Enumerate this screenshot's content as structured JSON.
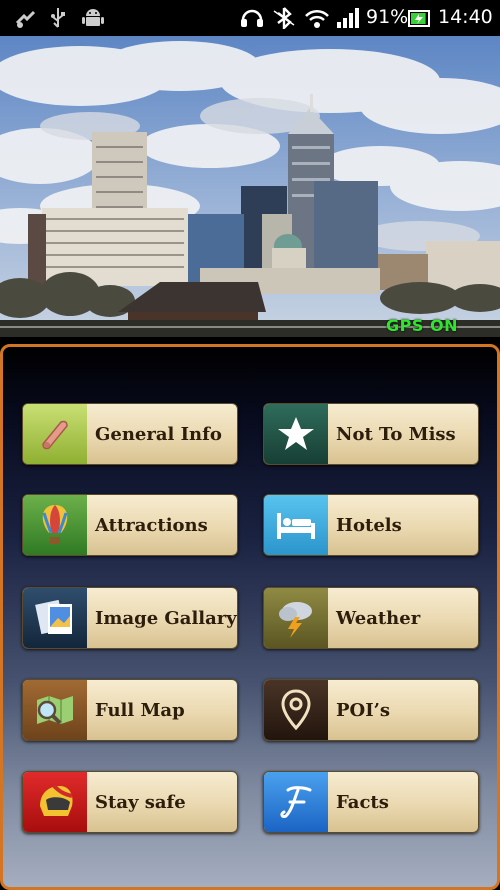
{
  "status_bar": {
    "icons_left": [
      "signal-sync-icon",
      "usb-icon",
      "android-icon"
    ],
    "icons_right": [
      "headset-icon",
      "bluetooth-icon",
      "wifi-icon",
      "cell-signal-icon"
    ],
    "battery_percent": "91%",
    "battery_level": 0.91,
    "time": "14:40"
  },
  "hero": {
    "gps_status": "GPS ON",
    "gps_color": "#2ee62e"
  },
  "menu": {
    "items": [
      {
        "label": "General Info",
        "icon": "scroll-icon"
      },
      {
        "label": "Not To Miss",
        "icon": "star-icon"
      },
      {
        "label": "Attractions",
        "icon": "hot-air-balloon-icon"
      },
      {
        "label": "Hotels",
        "icon": "bed-icon"
      },
      {
        "label": "Image Gallary",
        "icon": "photos-icon"
      },
      {
        "label": "Weather",
        "icon": "storm-cloud-icon"
      },
      {
        "label": "Full Map",
        "icon": "map-magnifier-icon"
      },
      {
        "label": "POI’s",
        "icon": "map-pin-icon"
      },
      {
        "label": "Stay safe",
        "icon": "helmet-icon"
      },
      {
        "label": "Facts",
        "icon": "f-letter-icon"
      }
    ]
  },
  "colors": {
    "panel_border": "#d37523",
    "button_face": "#ead8b0",
    "label_text": "#2c1d0c"
  }
}
